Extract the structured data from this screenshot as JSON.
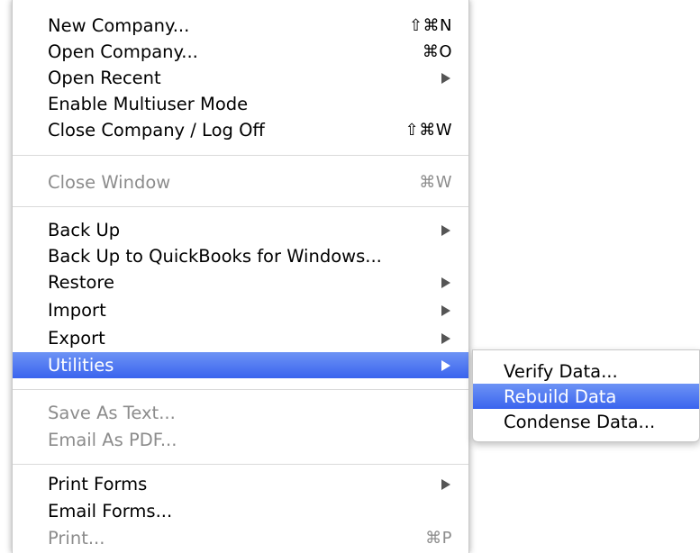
{
  "file_menu": {
    "items": [
      {
        "label": "New Company...",
        "shortcut": "⇧⌘N"
      },
      {
        "label": "Open Company...",
        "shortcut": "⌘O"
      },
      {
        "label": "Open Recent"
      },
      {
        "label": "Enable Multiuser Mode"
      },
      {
        "label": "Close Company / Log Off",
        "shortcut": "⇧⌘W"
      },
      {
        "label": "Close Window",
        "shortcut": "⌘W"
      },
      {
        "label": "Back Up"
      },
      {
        "label": "Back Up to QuickBooks for Windows..."
      },
      {
        "label": "Restore"
      },
      {
        "label": "Import"
      },
      {
        "label": "Export"
      },
      {
        "label": "Utilities"
      },
      {
        "label": "Save As Text..."
      },
      {
        "label": "Email As PDF..."
      },
      {
        "label": "Print Forms"
      },
      {
        "label": "Email Forms..."
      },
      {
        "label": "Print...",
        "shortcut": "⌘P"
      }
    ]
  },
  "utilities_submenu": {
    "items": [
      {
        "label": "Verify Data..."
      },
      {
        "label": "Rebuild Data"
      },
      {
        "label": "Condense Data..."
      }
    ]
  },
  "colors": {
    "highlight": "#3a64ee",
    "disabled_text": "#8c8c8c"
  }
}
